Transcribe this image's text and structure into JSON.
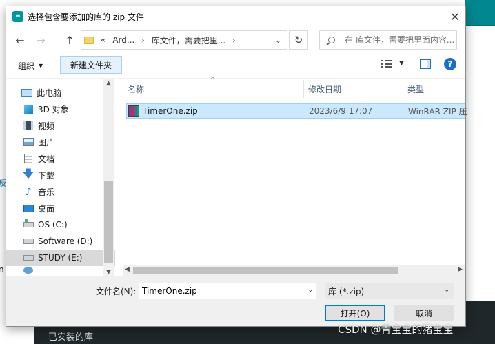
{
  "background": {
    "bottom_text": "已安装的库",
    "left_glyph_1": "反",
    "left_glyph_2": "n"
  },
  "dialog": {
    "title": "选择包含要添加的库的 zip 文件",
    "app_icon_glyph": "∞",
    "close_glyph": "✕"
  },
  "nav": {
    "back": "←",
    "forward": "→",
    "up": "↑",
    "refresh": "↻",
    "address": {
      "prefix": "«",
      "segment_1": "Ard...",
      "segment_2": "库文件，需要把里...",
      "chevron": "›",
      "dropdown": "⌄"
    },
    "search_placeholder": "在 库文件，需要把里面内容..."
  },
  "toolbar": {
    "organize_label": "组织",
    "organize_caret": "▼",
    "new_folder_label": "新建文件夹",
    "view_caret": "▼",
    "help_glyph": "?"
  },
  "sidebar": {
    "items": [
      {
        "label": "此电脑",
        "icon": "computer-icon"
      },
      {
        "label": "3D 对象",
        "icon": "cube-3d-icon"
      },
      {
        "label": "视频",
        "icon": "video-icon"
      },
      {
        "label": "图片",
        "icon": "pictures-icon"
      },
      {
        "label": "文档",
        "icon": "documents-icon"
      },
      {
        "label": "下载",
        "icon": "download-icon"
      },
      {
        "label": "音乐",
        "icon": "music-icon"
      },
      {
        "label": "桌面",
        "icon": "desktop-icon"
      },
      {
        "label": "OS (C:)",
        "icon": "os-drive-icon"
      },
      {
        "label": "Software (D:)",
        "icon": "drive-icon"
      },
      {
        "label": "STUDY (E:)",
        "icon": "drive-icon",
        "selected": true
      }
    ],
    "download_glyph": "🡇",
    "music_glyph": "♪"
  },
  "files": {
    "columns": {
      "name": "名称",
      "date": "修改日期",
      "type": "类型"
    },
    "sort_glyph": "^",
    "rows": [
      {
        "name": "TimerOne.zip",
        "date": "2023/6/9 17:07",
        "type": "WinRAR ZIP 压",
        "icon": "zip-archive-icon",
        "selected": true
      }
    ]
  },
  "scroll": {
    "up": "▲",
    "down": "▼",
    "left": "◀",
    "right": "▶"
  },
  "footer": {
    "filename_label": "文件名(N):",
    "filename_value": "TimerOne.zip",
    "filetype_value": "库 (*.zip)",
    "dropdown": "⌄",
    "open_label": "打开(O)",
    "cancel_label": "取消"
  },
  "watermark": "CSDN @青宝宝的猪宝宝"
}
